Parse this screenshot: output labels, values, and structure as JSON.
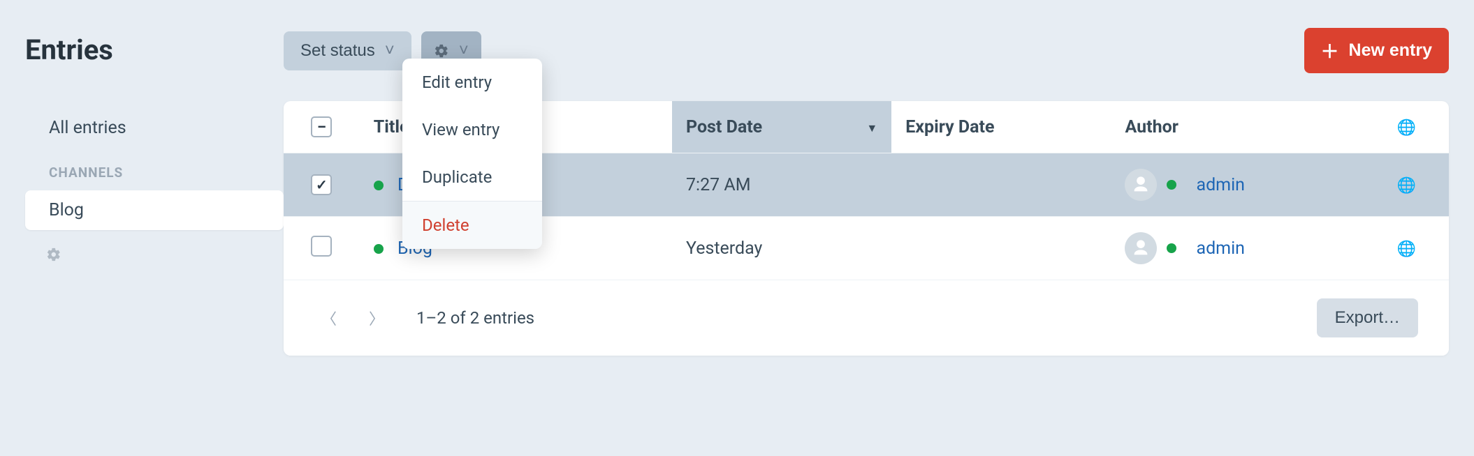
{
  "page_title": "Entries",
  "sidebar": {
    "items": [
      {
        "label": "All entries",
        "active": false
      }
    ],
    "section_label": "Channels",
    "channel_items": [
      {
        "label": "Blog",
        "active": true
      }
    ]
  },
  "toolbar": {
    "set_status_label": "Set status",
    "new_entry_label": "New entry"
  },
  "dropdown": {
    "items": [
      {
        "label": "Edit entry"
      },
      {
        "label": "View entry"
      },
      {
        "label": "Duplicate"
      }
    ],
    "delete_label": "Delete"
  },
  "table": {
    "headers": {
      "title": "Title",
      "post_date": "Post Date",
      "expiry_date": "Expiry Date",
      "author": "Author"
    },
    "rows": [
      {
        "checked": true,
        "title": "Dele",
        "post_date": "7:27 AM",
        "expiry_date": "",
        "author": "admin"
      },
      {
        "checked": false,
        "title": "Blog",
        "post_date": "Yesterday",
        "expiry_date": "",
        "author": "admin"
      }
    ]
  },
  "footer": {
    "range_text": "1–2 of 2 entries",
    "export_label": "Export…"
  }
}
